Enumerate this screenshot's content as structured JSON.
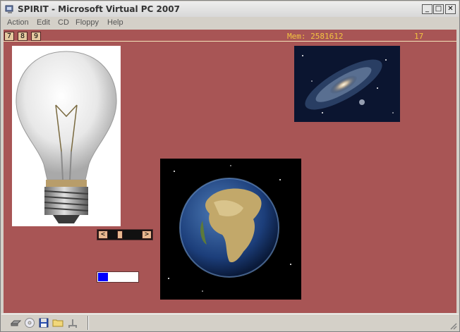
{
  "window": {
    "title": "SPIRIT - Microsoft Virtual PC 2007",
    "controls": {
      "minimize": "_",
      "maximize": "□",
      "close": "✕"
    }
  },
  "menubar": {
    "items": [
      "Action",
      "Edit",
      "CD",
      "Floppy",
      "Help"
    ]
  },
  "vm": {
    "background_color": "#a85555",
    "number_buttons": [
      "7",
      "8",
      "9"
    ],
    "memory_text": "Mem: 2581612",
    "counter_text": "17",
    "scrollbar": {
      "left_arrow": "<",
      "right_arrow": ">",
      "position": 0.25
    },
    "progress": {
      "value": 0.25,
      "fill_color": "#0000ff"
    },
    "images": [
      "lightbulb",
      "galaxy",
      "earth"
    ]
  },
  "statusbar": {
    "icons": [
      "hard-disk-icon",
      "cd-drive-icon",
      "floppy-disk-icon",
      "shared-folder-icon",
      "network-icon"
    ]
  }
}
